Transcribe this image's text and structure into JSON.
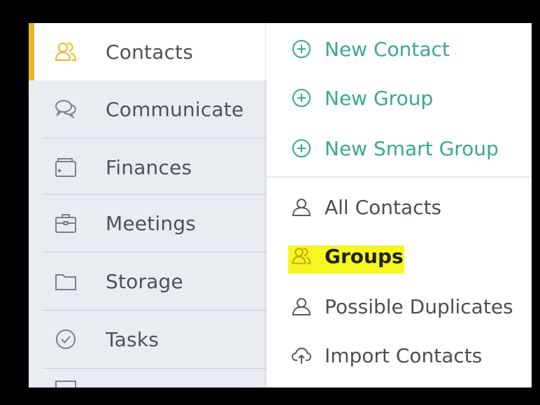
{
  "sidebar": {
    "items": [
      {
        "label": "Contacts",
        "icon": "contacts-icon",
        "active": true
      },
      {
        "label": "Communicate",
        "icon": "chat-icon"
      },
      {
        "label": "Finances",
        "icon": "wallet-icon"
      },
      {
        "label": "Meetings",
        "icon": "briefcase-icon"
      },
      {
        "label": "Storage",
        "icon": "folder-icon"
      },
      {
        "label": "Tasks",
        "icon": "check-circle-icon"
      }
    ]
  },
  "submenu": {
    "actions": [
      {
        "label": "New Contact",
        "icon": "plus-circle-icon"
      },
      {
        "label": "New Group",
        "icon": "plus-circle-icon"
      },
      {
        "label": "New Smart Group",
        "icon": "plus-circle-icon"
      }
    ],
    "links": [
      {
        "label": "All Contacts",
        "icon": "person-icon"
      },
      {
        "label": "Groups",
        "icon": "group-icon",
        "highlighted": true
      },
      {
        "label": "Possible Duplicates",
        "icon": "person-icon"
      },
      {
        "label": "Import Contacts",
        "icon": "cloud-upload-icon"
      }
    ]
  },
  "colors": {
    "accent_yellow": "#e8b823",
    "action_green": "#3aa890",
    "highlight": "#f7f71f",
    "sidebar_bg": "#e9ecf1"
  }
}
